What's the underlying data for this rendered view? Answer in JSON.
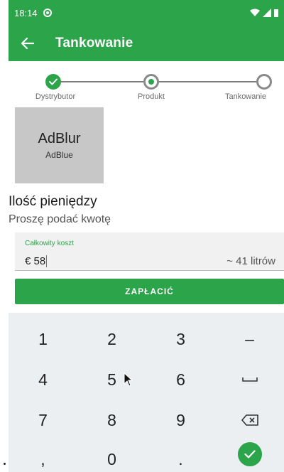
{
  "status_bar": {
    "time": "18:14"
  },
  "app_bar": {
    "title": "Tankowanie"
  },
  "stepper": {
    "steps": [
      {
        "label": "Dystrybutor",
        "state": "done"
      },
      {
        "label": "Produkt",
        "state": "active"
      },
      {
        "label": "Tankowanie",
        "state": "todo"
      }
    ]
  },
  "product": {
    "name": "AdBlur",
    "subtitle": "AdBlue"
  },
  "amount": {
    "heading": "Ilość pieniędzy",
    "subheading": "Proszę podać kwotę"
  },
  "cost_field": {
    "label": "Całkowity koszt",
    "currency": "€",
    "value": "58",
    "liters_estimate": "~ 41 litrów"
  },
  "pay_button": {
    "label": "ZAPŁACIĆ"
  },
  "keypad": {
    "keys": [
      "1",
      "2",
      "3",
      "–",
      "4",
      "5",
      "6",
      "␣",
      "7",
      "8",
      "9",
      "⌫",
      ",",
      "0",
      ".",
      "✓"
    ]
  },
  "colors": {
    "accent": "#2ba44a",
    "keypad_bg": "#eceff1",
    "tile_bg": "#c7c7c7"
  }
}
